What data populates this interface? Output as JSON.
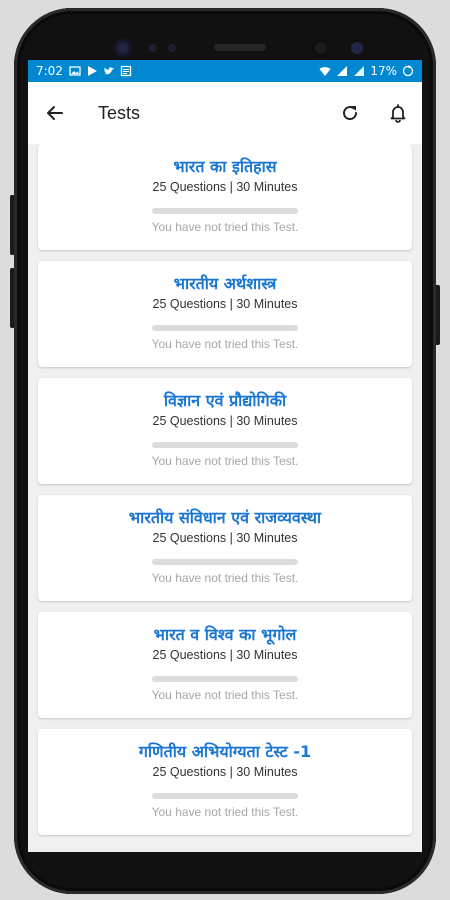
{
  "statusbar": {
    "time": "7:02",
    "battery": "17%",
    "color": "#0288d1"
  },
  "appbar": {
    "title": "Tests"
  },
  "tests": [
    {
      "title": "भारत का इतिहास",
      "meta": "25 Questions | 30 Minutes",
      "progress": 0,
      "status": "You have not tried this Test."
    },
    {
      "title": "भारतीय अर्थशास्त्र",
      "meta": "25 Questions | 30 Minutes",
      "progress": 0,
      "status": "You have not tried this Test."
    },
    {
      "title": "विज्ञान एवं प्रौद्योगिकी",
      "meta": "25 Questions | 30 Minutes",
      "progress": 0,
      "status": "You have not tried this Test."
    },
    {
      "title": "भारतीय संविधान एवं राजव्यवस्था",
      "meta": "25 Questions | 30 Minutes",
      "progress": 0,
      "status": "You have not tried this Test."
    },
    {
      "title": "भारत व विश्व का भूगोल",
      "meta": "25 Questions | 30 Minutes",
      "progress": 0,
      "status": "You have not tried this Test."
    },
    {
      "title": "गणितीय अभियोग्यता टेस्ट -1",
      "meta": "25 Questions | 30 Minutes",
      "progress": 0,
      "status": "You have not tried this Test."
    }
  ],
  "icons": {
    "back": "arrow-left-icon",
    "refresh": "refresh-icon",
    "notifications": "bell-icon"
  },
  "colors": {
    "title": "#1976d2",
    "accent": "#0288d1"
  }
}
